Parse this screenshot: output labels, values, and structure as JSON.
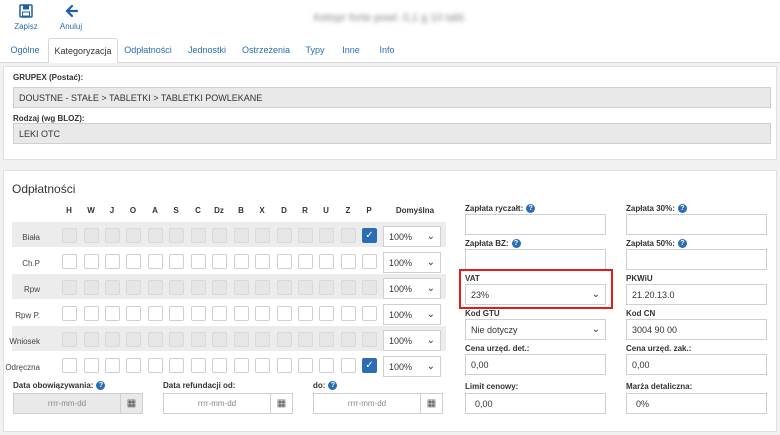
{
  "toolbar": {
    "save_label": "Zapisz",
    "cancel_label": "Anuluj",
    "record_title": "Ketopr forte powl. 0,1 g 10 tabl."
  },
  "tabs": [
    "Ogólne",
    "Kategoryzacja",
    "Odpłatności",
    "Jednostki",
    "Ostrzeżenia",
    "Typy",
    "Inne",
    "Info"
  ],
  "active_tab": "Kategoryzacja",
  "categorization": {
    "grupex_label": "GRUPEX (Postać):",
    "grupex_value": "DOUSTNE - STAŁE > TABLETKI > TABLETKI POWLEKANE",
    "rodzaj_label": "Rodzaj (wg BLOZ):",
    "rodzaj_value": "LEKI OTC"
  },
  "odplatnosci": {
    "title": "Odpłatności",
    "columns": [
      "H",
      "W",
      "J",
      "O",
      "A",
      "S",
      "C",
      "Dz",
      "B",
      "X",
      "D",
      "R",
      "U",
      "Z",
      "P"
    ],
    "default_header": "Domyślna",
    "rows": [
      {
        "label": "Biała",
        "default": "100%"
      },
      {
        "label": "Ch.P",
        "default": "100%"
      },
      {
        "label": "Rpw",
        "default": "100%"
      },
      {
        "label": "Rpw P.",
        "default": "100%"
      },
      {
        "label": "Wniosek",
        "default": "100%"
      },
      {
        "label": "Odręczna",
        "default": "100%"
      }
    ],
    "date_valid_label": "Data obowiązywania:",
    "date_refund_label": "Data refundacji od:",
    "date_to_label": "do:",
    "date_placeholder": "rrrr-mm-dd"
  },
  "right_fields": {
    "zaplata_ryczalt_label": "Zapłata ryczałt:",
    "zaplata_ryczalt_value": "",
    "zaplata_30_label": "Zapłata 30%:",
    "zaplata_30_value": "",
    "zaplata_bz_label": "Zapłata BZ:",
    "zaplata_bz_value": "",
    "zaplata_50_label": "Zapłata 50%:",
    "zaplata_50_value": "",
    "vat_label": "VAT",
    "vat_value": "23%",
    "pkwiu_label": "PKWiU",
    "pkwiu_value": "21.20.13.0",
    "kod_gtu_label": "Kod GTU",
    "kod_gtu_value": "Nie dotyczy",
    "kod_cn_label": "Kod CN",
    "kod_cn_value": "3004 90 00",
    "cena_det_label": "Cena urzęd. det.:",
    "cena_det_value": "0,00",
    "cena_zak_label": "Cena urzęd. zak.:",
    "cena_zak_value": "0,00",
    "limit_label": "Limit cenowy:",
    "limit_value": "0,00",
    "marza_label": "Marża detaliczna:",
    "marza_value": "0%"
  },
  "colors": {
    "accent": "#2a6db5",
    "highlight": "#e51a1a"
  }
}
